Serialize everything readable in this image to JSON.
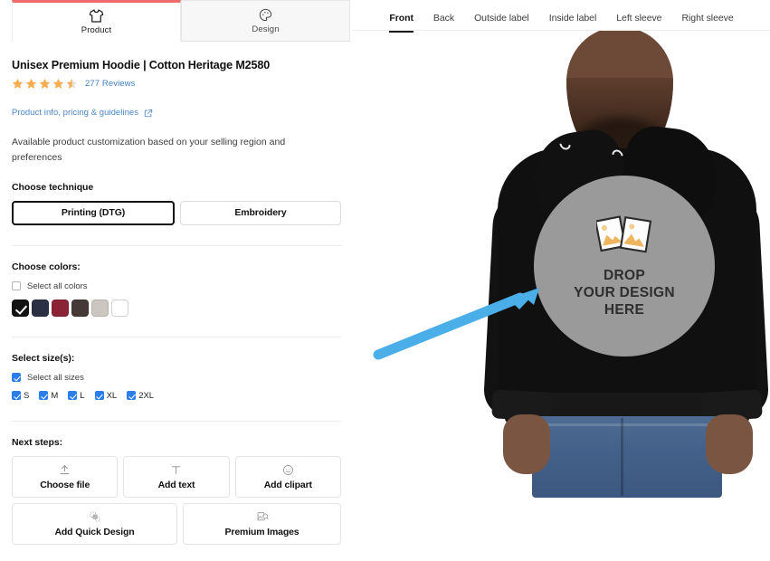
{
  "left_panel": {
    "tabs": [
      {
        "id": "product",
        "label": "Product",
        "icon": "tshirt-icon",
        "active": true
      },
      {
        "id": "design",
        "label": "Design",
        "icon": "palette-icon",
        "active": false
      }
    ],
    "product": {
      "title": "Unisex Premium Hoodie | Cotton Heritage M2580",
      "rating": 4.5,
      "stars_full": 4,
      "stars_half": 1,
      "reviews_text": "277 Reviews",
      "info_link": "Product info, pricing & guidelines",
      "info_link_icon": "external-link-icon",
      "description": "Available product customization based on your selling region and preferences"
    },
    "technique": {
      "label": "Choose technique",
      "options": [
        {
          "label": "Printing (DTG)",
          "selected": true
        },
        {
          "label": "Embroidery",
          "selected": false
        }
      ]
    },
    "colors": {
      "label": "Choose colors:",
      "select_all_label": "Select all colors",
      "select_all_checked": false,
      "swatches": [
        {
          "name": "black",
          "hex": "#131313",
          "selected": true
        },
        {
          "name": "navy",
          "hex": "#2b3044",
          "selected": false
        },
        {
          "name": "maroon",
          "hex": "#8c2437",
          "selected": false
        },
        {
          "name": "dark-brown",
          "hex": "#453a36",
          "selected": false
        },
        {
          "name": "light-grey",
          "hex": "#cbc7c0",
          "selected": false
        },
        {
          "name": "white",
          "hex": "#ffffff",
          "selected": false
        }
      ]
    },
    "sizes": {
      "label": "Select size(s):",
      "select_all_label": "Select all sizes",
      "select_all_checked": true,
      "items": [
        {
          "label": "S",
          "checked": true
        },
        {
          "label": "M",
          "checked": true
        },
        {
          "label": "L",
          "checked": true
        },
        {
          "label": "XL",
          "checked": true
        },
        {
          "label": "2XL",
          "checked": true
        }
      ]
    },
    "next_steps": {
      "label": "Next steps:",
      "row1": [
        {
          "label": "Choose file",
          "icon": "upload-icon"
        },
        {
          "label": "Add text",
          "icon": "text-t-icon"
        },
        {
          "label": "Add clipart",
          "icon": "smiley-icon"
        }
      ],
      "row2": [
        {
          "label": "Add Quick Design",
          "icon": "layers-icon"
        },
        {
          "label": "Premium Images",
          "icon": "premium-image-icon"
        }
      ]
    }
  },
  "right_panel": {
    "view_tabs": [
      {
        "label": "Front",
        "active": true
      },
      {
        "label": "Back",
        "active": false
      },
      {
        "label": "Outside label",
        "active": false
      },
      {
        "label": "Inside label",
        "active": false
      },
      {
        "label": "Left sleeve",
        "active": false
      },
      {
        "label": "Right sleeve",
        "active": false
      }
    ],
    "dropzone": {
      "line1": "DROP",
      "line2": "YOUR DESIGN",
      "line3": "HERE",
      "icon": "two-photos-icon",
      "fill_hex": "#9a9a9a"
    },
    "annotation": {
      "type": "arrow",
      "color_hex": "#4aaee8",
      "points_to": "dropzone"
    },
    "mockup": {
      "garment": "black hoodie on model",
      "garment_hex": "#101010"
    }
  },
  "theme": {
    "accent_blue": "#2b7de9",
    "link_blue": "#4a85c4",
    "tab_active_red": "#ef6a6a",
    "star_orange": "#f5ae52",
    "arrow_blue": "#4aaee8"
  }
}
